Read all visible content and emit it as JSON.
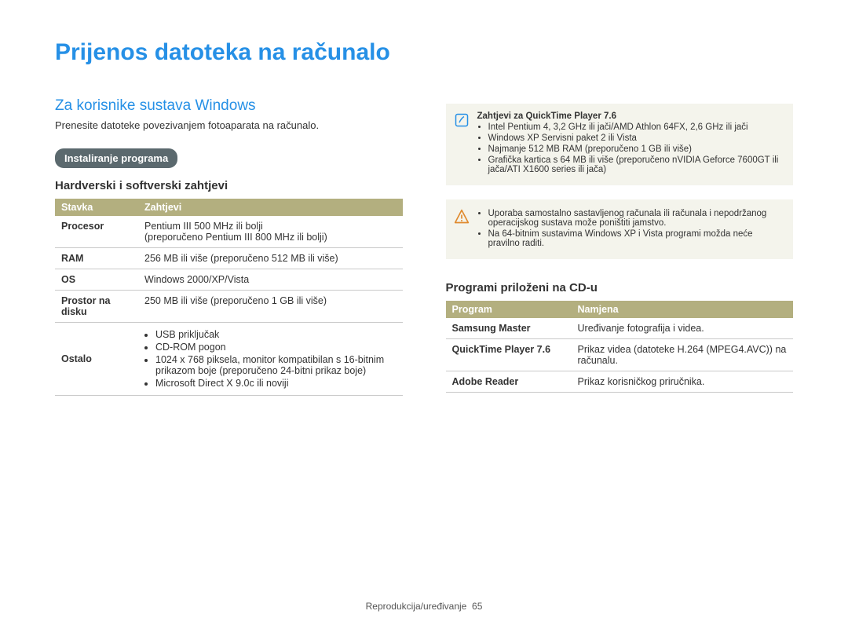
{
  "page_title": "Prijenos datoteka na računalo",
  "section_title": "Za korisnike sustava Windows",
  "intro": "Prenesite datoteke povezivanjem fotoaparata na računalo.",
  "pill": "Instaliranje programa",
  "left": {
    "subhead": "Hardverski i softverski zahtjevi",
    "headers": {
      "c1": "Stavka",
      "c2": "Zahtjevi"
    },
    "rows": {
      "proc": {
        "label": "Procesor",
        "text": "Pentium III 500 MHz ili bolji\n(preporučeno Pentium III 800 MHz ili bolji)"
      },
      "ram": {
        "label": "RAM",
        "text": "256 MB ili više (preporučeno 512 MB ili više)"
      },
      "os": {
        "label": "OS",
        "text": "Windows 2000/XP/Vista"
      },
      "disk": {
        "label": "Prostor na disku",
        "text": "250 MB ili više (preporučeno 1 GB ili više)"
      },
      "other": {
        "label": "Ostalo",
        "items": [
          "USB priključak",
          "CD-ROM pogon",
          "1024 x 768 piksela, monitor kompatibilan s 16-bitnim prikazom boje (preporučeno 24-bitni prikaz boje)",
          "Microsoft Direct X 9.0c ili noviji"
        ]
      }
    }
  },
  "note": {
    "title": "Zahtjevi za QuickTime Player 7.6",
    "items": [
      "Intel Pentium 4, 3,2 GHz ili jači/AMD Athlon 64FX, 2,6 GHz ili jači",
      "Windows XP Servisni paket 2 ili Vista",
      "Najmanje 512 MB RAM (preporučeno 1 GB ili više)",
      "Grafička kartica s 64 MB ili više (preporučeno nVIDIA Geforce 7600GT ili jača/ATI X1600 series ili jača)"
    ]
  },
  "warn": {
    "items": [
      "Uporaba samostalno sastavljenog računala ili računala i nepodržanog operacijskog sustava može poništiti jamstvo.",
      "Na 64-bitnim sustavima Windows XP i Vista programi možda neće pravilno raditi."
    ]
  },
  "right": {
    "subhead": "Programi priloženi na CD-u",
    "headers": {
      "c1": "Program",
      "c2": "Namjena"
    },
    "rows": {
      "sm": {
        "label": "Samsung Master",
        "text": "Uređivanje fotografija i videa."
      },
      "qt": {
        "label": "QuickTime Player 7.6",
        "text": "Prikaz videa (datoteke H.264 (MPEG4.AVC)) na računalu."
      },
      "ar": {
        "label": "Adobe Reader",
        "text": "Prikaz korisničkog priručnika."
      }
    }
  },
  "footer": {
    "label": "Reprodukcija/uređivanje",
    "page": "65"
  }
}
